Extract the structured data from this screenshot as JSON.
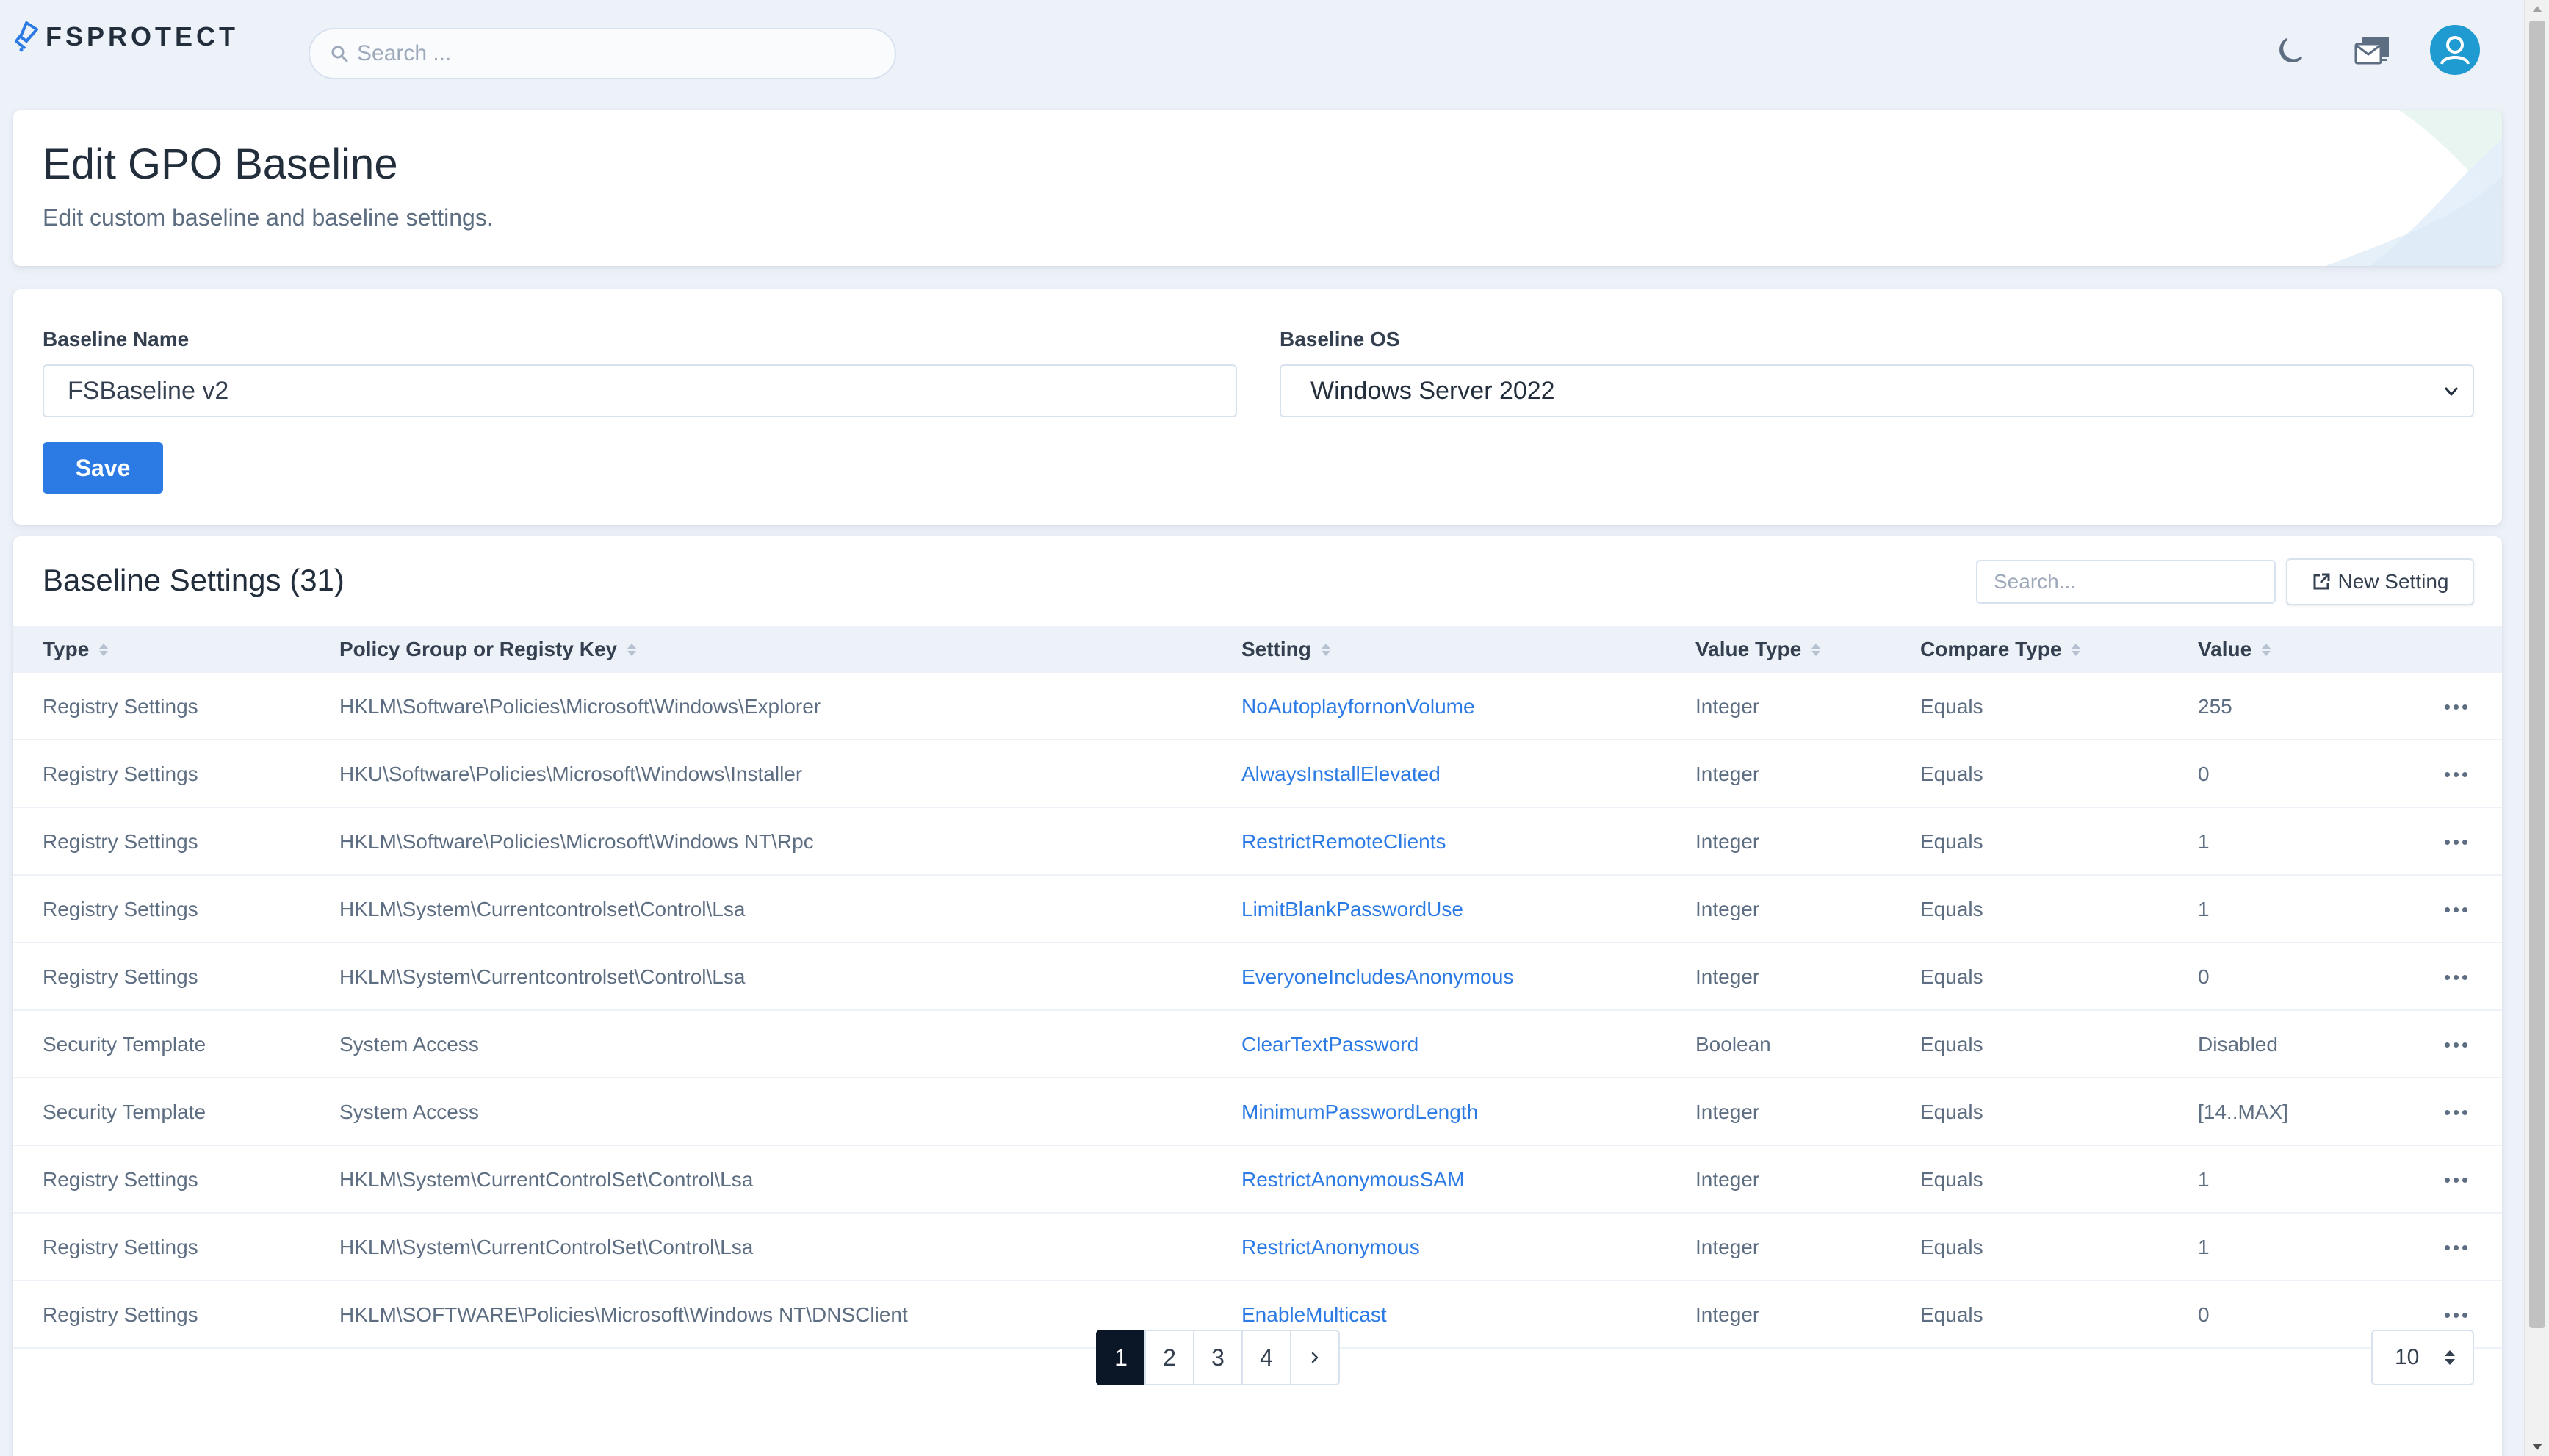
{
  "brand": {
    "name": "FSPROTECT"
  },
  "search": {
    "placeholder": "Search ..."
  },
  "header": {
    "title": "Edit GPO Baseline",
    "subtitle": "Edit custom baseline and baseline settings."
  },
  "form": {
    "name_label": "Baseline Name",
    "name_value": "FSBaseline v2",
    "os_label": "Baseline OS",
    "os_value": "Windows Server 2022",
    "save_label": "Save"
  },
  "settings": {
    "title": "Baseline Settings (31)",
    "search_placeholder": "Search...",
    "new_label": "New Setting",
    "columns": [
      "Type",
      "Policy Group or Registy Key",
      "Setting",
      "Value Type",
      "Compare Type",
      "Value"
    ],
    "rows": [
      [
        "Registry Settings",
        "HKLM\\Software\\Policies\\Microsoft\\Windows\\Explorer",
        "NoAutoplayfornonVolume",
        "Integer",
        "Equals",
        "255"
      ],
      [
        "Registry Settings",
        "HKU\\Software\\Policies\\Microsoft\\Windows\\Installer",
        "AlwaysInstallElevated",
        "Integer",
        "Equals",
        "0"
      ],
      [
        "Registry Settings",
        "HKLM\\Software\\Policies\\Microsoft\\Windows NT\\Rpc",
        "RestrictRemoteClients",
        "Integer",
        "Equals",
        "1"
      ],
      [
        "Registry Settings",
        "HKLM\\System\\Currentcontrolset\\Control\\Lsa",
        "LimitBlankPasswordUse",
        "Integer",
        "Equals",
        "1"
      ],
      [
        "Registry Settings",
        "HKLM\\System\\Currentcontrolset\\Control\\Lsa",
        "EveryoneIncludesAnonymous",
        "Integer",
        "Equals",
        "0"
      ],
      [
        "Security Template",
        "System Access",
        "ClearTextPassword",
        "Boolean",
        "Equals",
        "Disabled"
      ],
      [
        "Security Template",
        "System Access",
        "MinimumPasswordLength",
        "Integer",
        "Equals",
        "[14..MAX]"
      ],
      [
        "Registry Settings",
        "HKLM\\System\\CurrentControlSet\\Control\\Lsa",
        "RestrictAnonymousSAM",
        "Integer",
        "Equals",
        "1"
      ],
      [
        "Registry Settings",
        "HKLM\\System\\CurrentControlSet\\Control\\Lsa",
        "RestrictAnonymous",
        "Integer",
        "Equals",
        "1"
      ],
      [
        "Registry Settings",
        "HKLM\\SOFTWARE\\Policies\\Microsoft\\Windows NT\\DNSClient",
        "EnableMulticast",
        "Integer",
        "Equals",
        "0"
      ]
    ]
  },
  "pagination": {
    "pages": [
      "1",
      "2",
      "3",
      "4"
    ],
    "current": "1",
    "next_icon": "chevron-right-icon",
    "page_size": "10"
  },
  "icons": {
    "theme": "moon-icon",
    "messages": "mail-stack-icon",
    "user": "user-avatar-icon"
  },
  "colors": {
    "accent": "#2c7be5",
    "background": "#edf2f9",
    "dark": "#0b1727"
  }
}
